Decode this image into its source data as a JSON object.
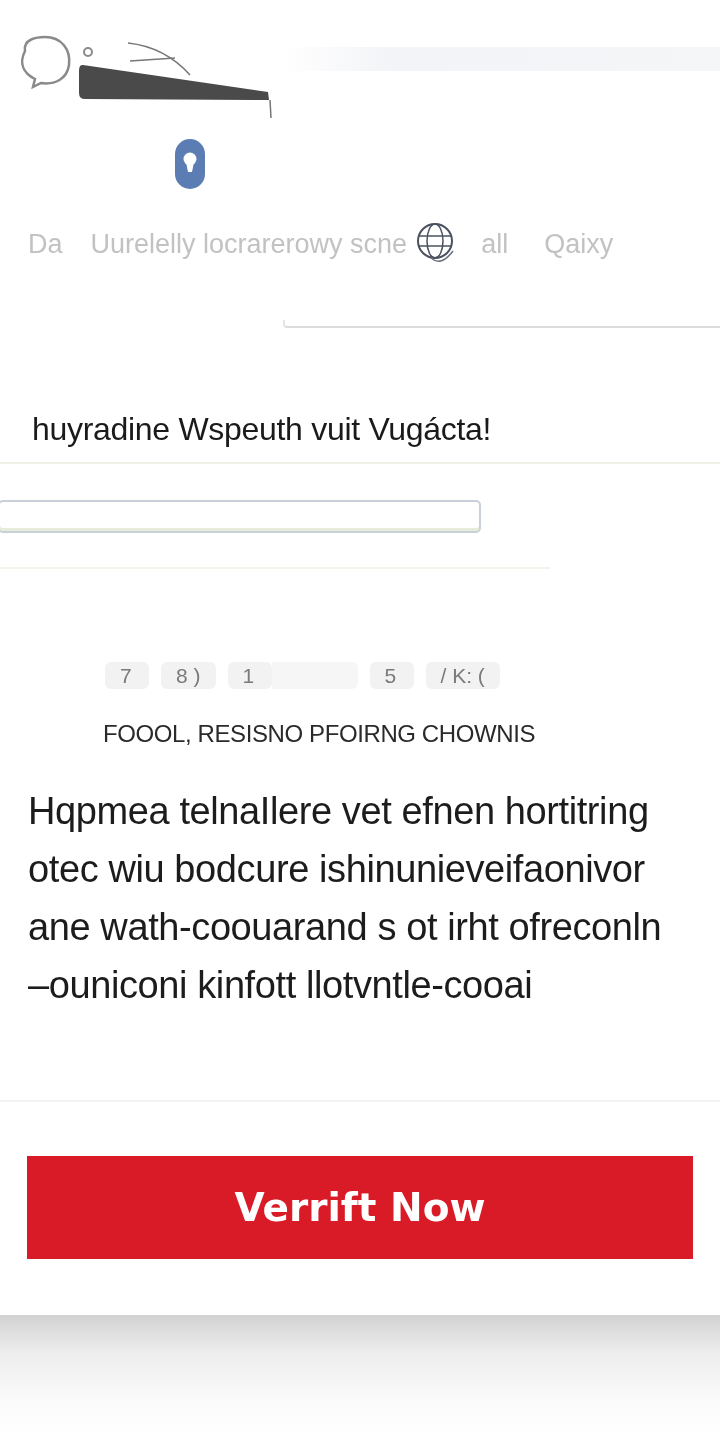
{
  "header": {
    "nav_items": [
      {
        "kind": "text",
        "label": "Da"
      },
      {
        "kind": "text",
        "label": "Uurelelly locrarerowy scne"
      },
      {
        "kind": "icon"
      },
      {
        "kind": "text",
        "label": "all"
      },
      {
        "kind": "text",
        "label": "Qaixy"
      }
    ]
  },
  "heading": "huyradine Wspeuth vuit Vugácta!",
  "code_boxes": [
    {
      "kind": "digit",
      "value": "7"
    },
    {
      "kind": "digit",
      "value": "8 )"
    },
    {
      "kind": "digit",
      "value": "1"
    },
    {
      "kind": "blank"
    },
    {
      "kind": "digit",
      "value": "5"
    },
    {
      "kind": "digit",
      "value": "/ K: ("
    }
  ],
  "caption": "FOOOL, RESISNO PFOIRNG CHOWNIS",
  "paragraph_lines": [
    "Hqpmea telnaIlere vet efnen hortitring",
    "otec wiu bodcure ishinunieveifaonivor",
    "ane wath-coouarand s ot irht ofreconln",
    "–ouniconi kinfott llotvntle-cooai"
  ],
  "button": {
    "label": "Verrift Now"
  }
}
